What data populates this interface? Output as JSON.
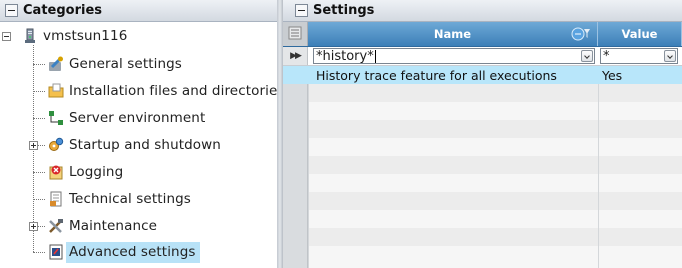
{
  "categories_panel": {
    "title": "Categories",
    "root": {
      "label": "vmstsun116",
      "icon": "server-icon"
    },
    "items": [
      {
        "label": "General settings",
        "icon": "wrench-icon",
        "expandable": false
      },
      {
        "label": "Installation files and directories",
        "icon": "folder-icon",
        "expandable": false
      },
      {
        "label": "Server environment",
        "icon": "network-icon",
        "expandable": false
      },
      {
        "label": "Startup and shutdown",
        "icon": "gears-icon",
        "expandable": true
      },
      {
        "label": "Logging",
        "icon": "error-log-icon",
        "expandable": false
      },
      {
        "label": "Technical settings",
        "icon": "document-icon",
        "expandable": false
      },
      {
        "label": "Maintenance",
        "icon": "tools-icon",
        "expandable": true
      },
      {
        "label": "Advanced settings",
        "icon": "advanced-doc-icon",
        "expandable": false,
        "selected": true
      }
    ]
  },
  "settings_panel": {
    "title": "Settings",
    "columns": {
      "name": "Name",
      "value": "Value"
    },
    "filter": {
      "name": "*history*",
      "value": "*"
    },
    "rows": [
      {
        "name": "History trace feature for all executions",
        "value": "Yes"
      }
    ]
  }
}
